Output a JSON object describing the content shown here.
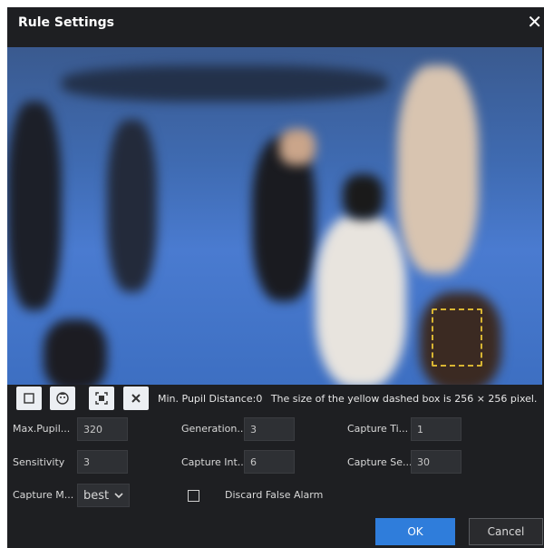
{
  "dialog": {
    "title": "Rule Settings",
    "close_glyph": "✕"
  },
  "toolbar": {
    "tools": [
      {
        "icon": "rectangle-icon"
      },
      {
        "icon": "face-icon"
      },
      {
        "icon": "target-box-icon"
      },
      {
        "icon": "delete-icon"
      }
    ],
    "min_pupil_text": "Min. Pupil Distance:0",
    "size_text": "The size of the yellow dashed box is 256 × 256 pixel."
  },
  "fields": {
    "max_pupil": {
      "label": "Max.Pupil...",
      "value": "320"
    },
    "generation": {
      "label": "Generation...",
      "value": "3"
    },
    "capture_times": {
      "label": "Capture Ti...",
      "value": "1"
    },
    "sensitivity": {
      "label": "Sensitivity",
      "value": "3"
    },
    "capture_interval": {
      "label": "Capture Int...",
      "value": "6"
    },
    "capture_sec": {
      "label": "Capture Se...",
      "value": "30"
    },
    "capture_mode": {
      "label": "Capture M...",
      "value": "best"
    },
    "discard": {
      "label": "Discard False Alarm"
    }
  },
  "buttons": {
    "ok": "OK",
    "cancel": "Cancel"
  },
  "colors": {
    "accent": "#2f7ddb",
    "background": "#1e1f22",
    "box": "#d8b533"
  }
}
